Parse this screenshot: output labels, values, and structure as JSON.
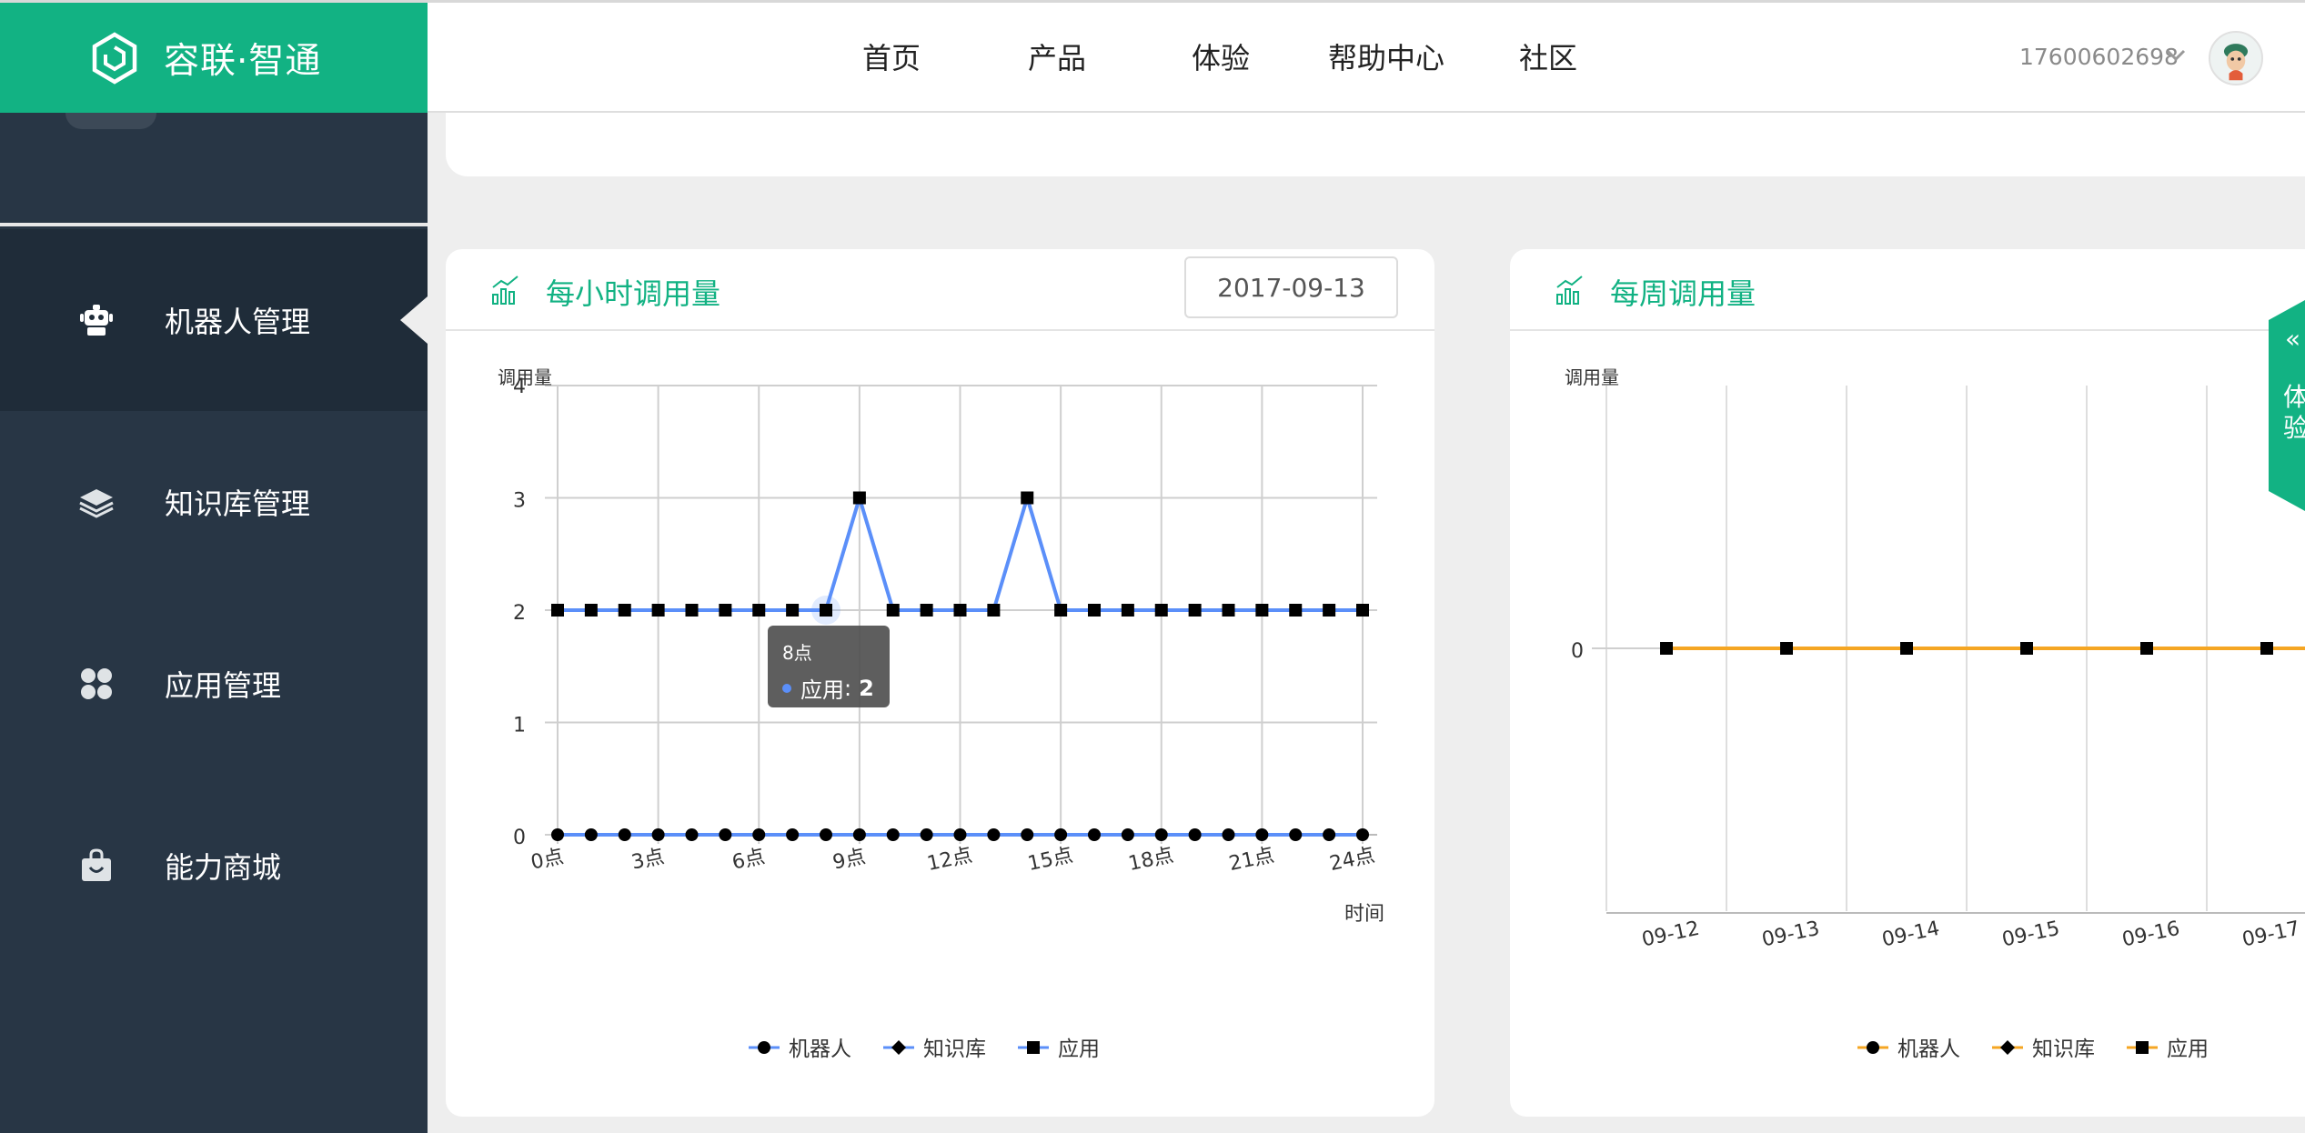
{
  "brand": {
    "name": "容联·智通"
  },
  "nav": [
    "首页",
    "产品",
    "体验",
    "帮助中心",
    "社区"
  ],
  "user": {
    "phone": "17600602698"
  },
  "sidebar": {
    "items": [
      {
        "label": "机器人管理",
        "icon": "robot-icon",
        "active": true
      },
      {
        "label": "知识库管理",
        "icon": "layers-icon",
        "active": false
      },
      {
        "label": "应用管理",
        "icon": "app-grid-icon",
        "active": false
      },
      {
        "label": "能力商城",
        "icon": "shop-bag-icon",
        "active": false
      }
    ]
  },
  "hourly": {
    "title": "每小时调用量",
    "date": "2017-09-13",
    "tooltip": {
      "title": "8点",
      "series": "应用",
      "value": "2"
    }
  },
  "weekly": {
    "title": "每周调用量"
  },
  "float_tab": {
    "label": "体验"
  },
  "colors": {
    "brand": "#12b283",
    "sidebar": "#283645",
    "hourly_line": "#5b8ff9",
    "weekly_line": "#f5a623"
  },
  "chart_data": [
    {
      "type": "line",
      "ylabel": "调用量",
      "xlabel": "时间",
      "ylim": [
        0,
        4
      ],
      "yticks": [
        "0",
        "1",
        "2",
        "3",
        "4"
      ],
      "x": [
        "0点",
        "1点",
        "2点",
        "3点",
        "4点",
        "5点",
        "6点",
        "7点",
        "8点",
        "9点",
        "10点",
        "11点",
        "12点",
        "13点",
        "14点",
        "15点",
        "16点",
        "17点",
        "18点",
        "19点",
        "20点",
        "21点",
        "22点",
        "23点",
        "24点"
      ],
      "xtick_labels": [
        "0点",
        "3点",
        "6点",
        "9点",
        "12点",
        "15点",
        "18点",
        "21点",
        "24点"
      ],
      "series": [
        {
          "name": "机器人",
          "marker": "circle",
          "values": [
            0,
            0,
            0,
            0,
            0,
            0,
            0,
            0,
            0,
            0,
            0,
            0,
            0,
            0,
            0,
            0,
            0,
            0,
            0,
            0,
            0,
            0,
            0,
            0,
            0
          ]
        },
        {
          "name": "知识库",
          "marker": "diamond",
          "values": [
            0,
            0,
            0,
            0,
            0,
            0,
            0,
            0,
            0,
            0,
            0,
            0,
            0,
            0,
            0,
            0,
            0,
            0,
            0,
            0,
            0,
            0,
            0,
            0,
            0
          ]
        },
        {
          "name": "应用",
          "marker": "square",
          "values": [
            2,
            2,
            2,
            2,
            2,
            2,
            2,
            2,
            2,
            3,
            2,
            2,
            2,
            2,
            3,
            2,
            2,
            2,
            2,
            2,
            2,
            2,
            2,
            2,
            2
          ]
        }
      ],
      "grid": true,
      "legend": "bottom"
    },
    {
      "type": "line",
      "ylabel": "调用量",
      "yticks": [
        "0"
      ],
      "x": [
        "09-12",
        "09-13",
        "09-14",
        "09-15",
        "09-16",
        "09-17"
      ],
      "series": [
        {
          "name": "机器人",
          "marker": "circle",
          "values": [
            0,
            0,
            0,
            0,
            0,
            0
          ]
        },
        {
          "name": "知识库",
          "marker": "diamond",
          "values": [
            0,
            0,
            0,
            0,
            0,
            0
          ]
        },
        {
          "name": "应用",
          "marker": "square",
          "values": [
            0,
            0,
            0,
            0,
            0,
            0
          ]
        }
      ],
      "grid": true,
      "legend": "bottom"
    }
  ]
}
